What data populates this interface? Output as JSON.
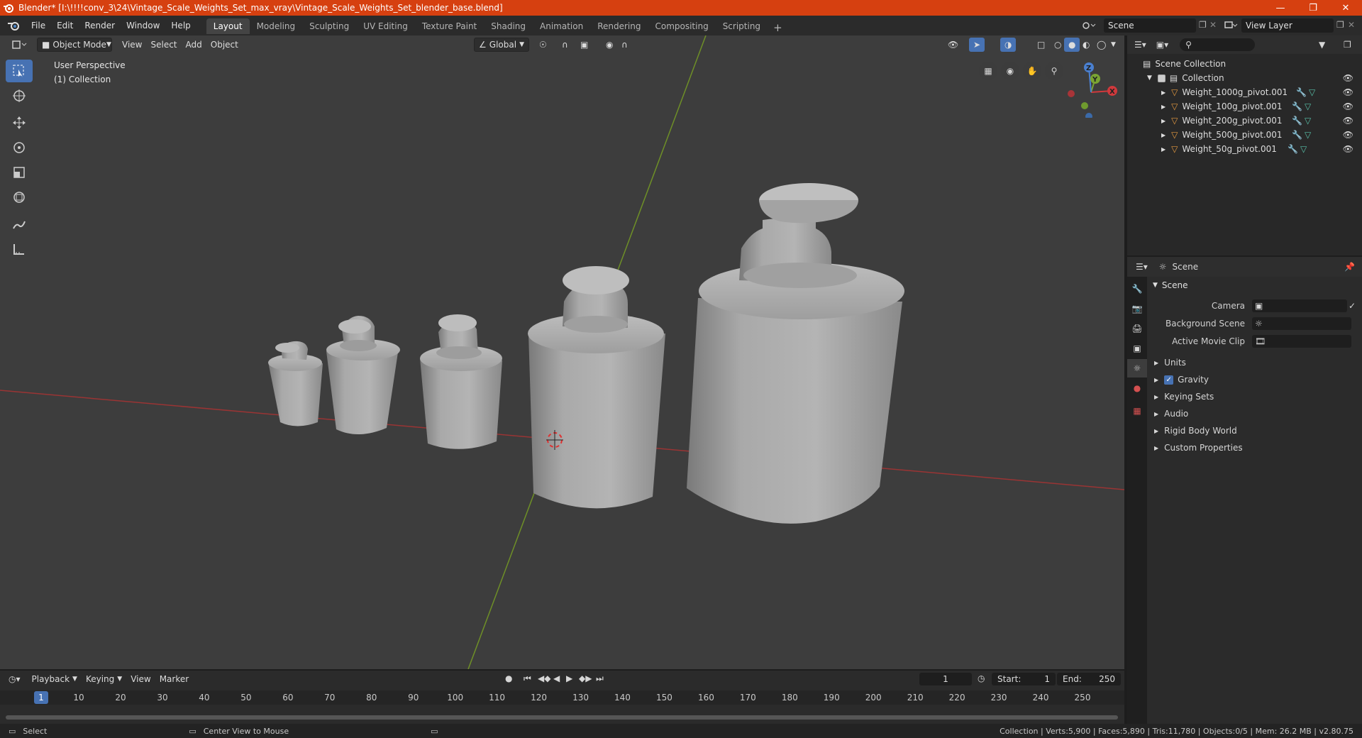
{
  "window": {
    "title": "Blender* [I:\\!!!!conv_3\\24\\Vintage_Scale_Weights_Set_max_vray\\Vintage_Scale_Weights_Set_blender_base.blend]",
    "accent": "#d64010"
  },
  "menu": [
    "File",
    "Edit",
    "Render",
    "Window",
    "Help"
  ],
  "workspaces": [
    "Layout",
    "Modeling",
    "Sculpting",
    "UV Editing",
    "Texture Paint",
    "Shading",
    "Animation",
    "Rendering",
    "Compositing",
    "Scripting"
  ],
  "active_workspace": "Layout",
  "scene_name": "Scene",
  "view_layer": "View Layer",
  "viewport": {
    "mode": "Object Mode",
    "menus": [
      "View",
      "Select",
      "Add",
      "Object"
    ],
    "transform_orientation": "Global",
    "perspective_label": "User Perspective",
    "collection_label": "(1) Collection",
    "gizmo_axes": [
      "X",
      "Y",
      "Z"
    ]
  },
  "outliner": {
    "root": "Scene Collection",
    "collection": "Collection",
    "objects": [
      "Weight_1000g_pivot.001",
      "Weight_100g_pivot.001",
      "Weight_200g_pivot.001",
      "Weight_500g_pivot.001",
      "Weight_50g_pivot.001"
    ]
  },
  "properties": {
    "context": "Scene",
    "panel_title": "Scene",
    "camera_label": "Camera",
    "background_scene_label": "Background Scene",
    "active_movie_clip_label": "Active Movie Clip",
    "subpanels": {
      "units": "Units",
      "gravity": "Gravity",
      "keying_sets": "Keying Sets",
      "audio": "Audio",
      "rigid_body_world": "Rigid Body World",
      "custom_properties": "Custom Properties"
    },
    "gravity_enabled": true
  },
  "timeline": {
    "menus": [
      "Playback",
      "Keying",
      "View",
      "Marker"
    ],
    "current_frame": "1",
    "start_label": "Start:",
    "start": "1",
    "end_label": "End:",
    "end": "250",
    "ruler_ticks": [
      "1",
      "10",
      "20",
      "30",
      "40",
      "50",
      "60",
      "70",
      "80",
      "90",
      "100",
      "110",
      "120",
      "130",
      "140",
      "150",
      "160",
      "170",
      "180",
      "190",
      "200",
      "210",
      "220",
      "230",
      "240",
      "250"
    ]
  },
  "status": {
    "left_action": "Select",
    "middle_action": "Center View to Mouse",
    "stats": "Collection | Verts:5,900 | Faces:5,890 | Tris:11,780 | Objects:0/5 | Mem: 26.2 MB | v2.80.75"
  }
}
